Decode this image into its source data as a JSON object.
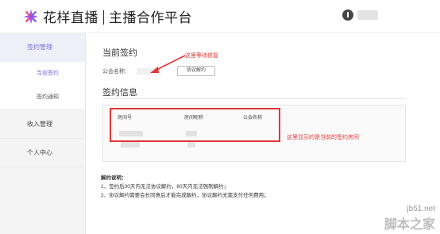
{
  "header": {
    "brand": "花样直播",
    "platform": "主播合作平台"
  },
  "sidebar": {
    "groups": [
      {
        "label": "签约管理",
        "items": [
          {
            "label": "当前签约"
          },
          {
            "label": "签约通知"
          }
        ]
      },
      {
        "label": "收入管理"
      },
      {
        "label": "个人中心"
      }
    ]
  },
  "main": {
    "current_section": {
      "title": "当前签约",
      "guild_label": "公会名称：",
      "cancel_button": "协议解约"
    },
    "info_section": {
      "title": "签约信息",
      "columns": [
        "房间号",
        "房间昵称",
        "公会名称"
      ]
    },
    "notes": {
      "title": "解约说明：",
      "items": [
        "1、签约后30天内无法协议解约，60天内无法强制解约；",
        "2、协议解约需要会长同意后才能完成解约，协议解约无需支付任何费用；"
      ]
    }
  },
  "annotations": {
    "fix_note": "这里等待修复",
    "room_note": "这里显示的是当前的签约房间"
  },
  "watermark": {
    "url": "jb51.net",
    "site": "脚本之家"
  },
  "colors": {
    "accent": "#7d68d6",
    "annotation": "#e23535"
  }
}
